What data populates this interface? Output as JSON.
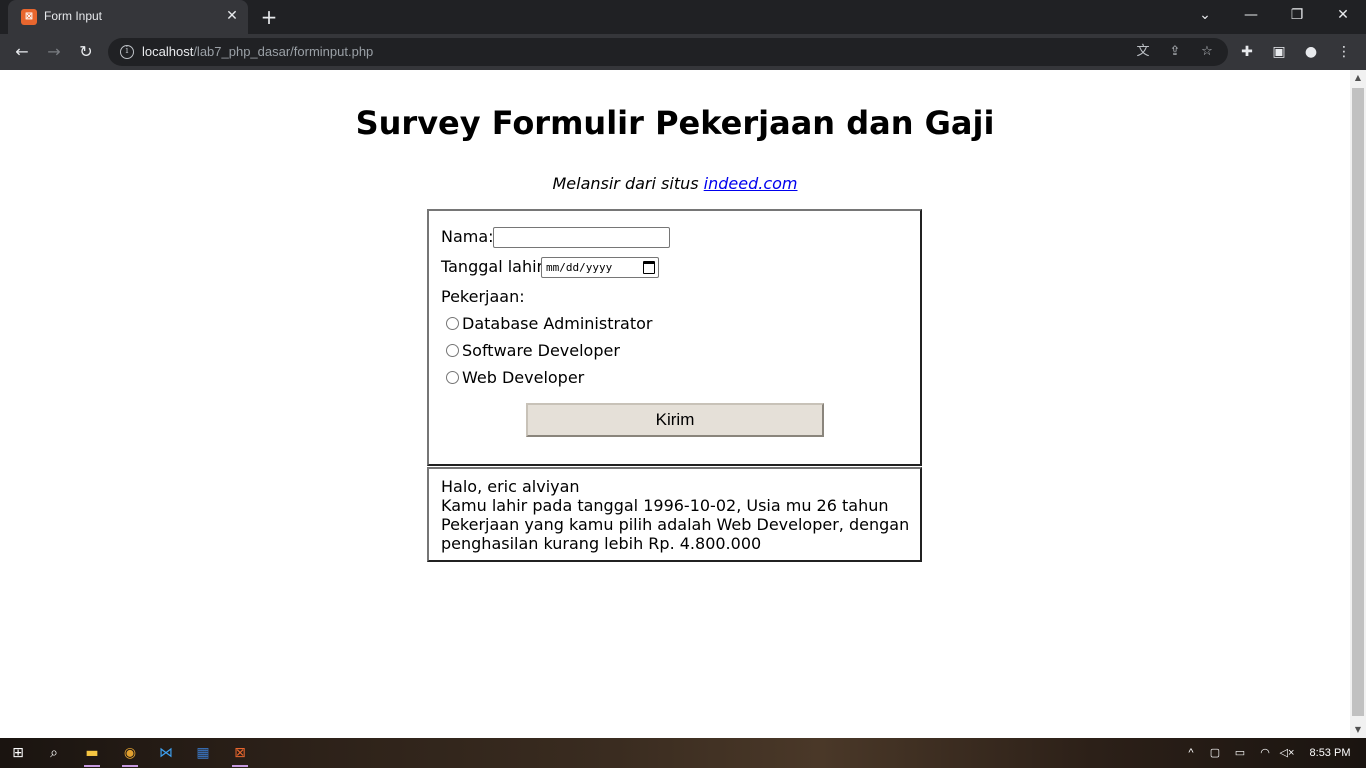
{
  "browser": {
    "tab_title": "Form Input",
    "url_host": "localhost",
    "url_path": "/lab7_php_dasar/forminput.php"
  },
  "page": {
    "heading": "Survey Formulir Pekerjaan dan Gaji",
    "subtitle_prefix": "Melansir dari situs",
    "subtitle_link": "indeed.com"
  },
  "form": {
    "nama_label": "Nama:",
    "nama_value": "",
    "tanggal_label": "Tanggal lahir:",
    "tanggal_placeholder": "mm/dd/yyyy",
    "pekerjaan_label": "Pekerjaan:",
    "options": [
      "Database Administrator",
      "Software Developer",
      "Web Developer"
    ],
    "submit_label": "Kirim"
  },
  "result": {
    "lines": [
      "Halo, eric alviyan",
      "Kamu lahir pada tanggal 1996-10-02, Usia mu 26 tahun",
      "Pekerjaan yang kamu pilih adalah Web Developer, dengan",
      "penghasilan kurang lebih Rp. 4.800.000"
    ]
  },
  "taskbar": {
    "time": "8:53 PM"
  },
  "icons": [
    "windows-start-icon",
    "search-icon",
    "file-explorer-icon",
    "chrome-icon",
    "vscode-icon",
    "virtualbox-icon",
    "xampp-icon"
  ],
  "colors": {
    "link": "#0000ee",
    "browser_frame": "#202124",
    "toolbar": "#35363a",
    "button_face": "#e5e0d8"
  }
}
